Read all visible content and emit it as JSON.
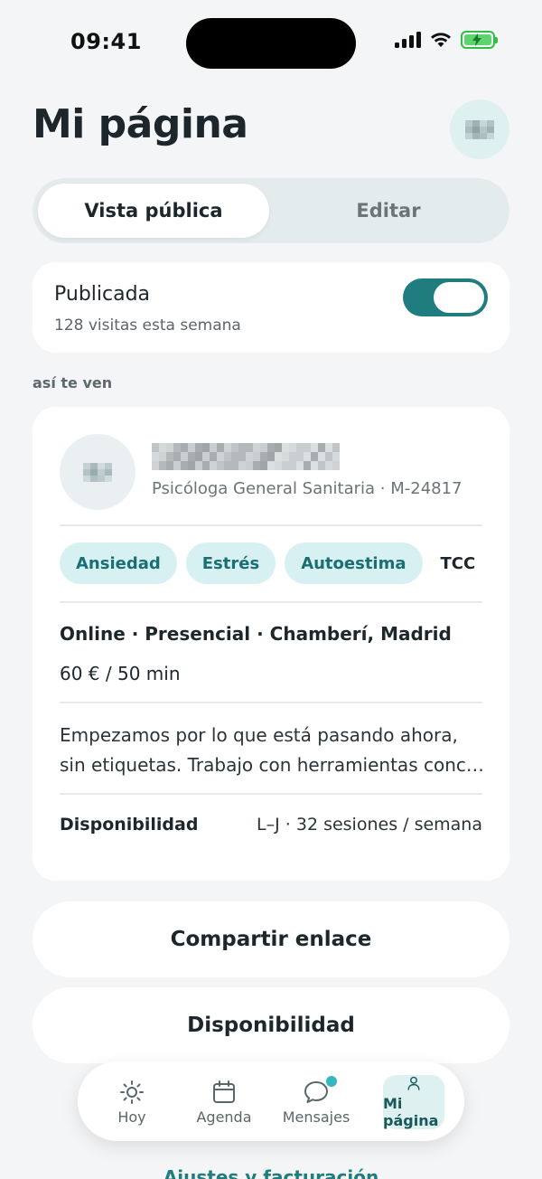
{
  "status_bar": {
    "time": "09:41"
  },
  "header": {
    "title": "Mi página"
  },
  "segmented": {
    "active": "Vista pública",
    "inactive": "Editar"
  },
  "publish": {
    "label": "Publicada",
    "visits": "128 visitas esta semana",
    "enabled": true
  },
  "preview_label": "así te ven",
  "profile": {
    "role": "Psicóloga General Sanitaria · M-24817",
    "chips": [
      "Ansiedad",
      "Estrés",
      "Autoestima",
      "TCC"
    ],
    "modes": "Online · Presencial · Chamberí, Madrid",
    "price": "60 € / 50 min",
    "bio_line1": "Empezamos por lo que está pasando ahora,",
    "bio_line2": "sin etiquetas. Trabajo con herramientas concr…",
    "availability_label": "Disponibilidad",
    "availability_value": "L–J · 32 sesiones / semana"
  },
  "actions": {
    "share": "Compartir enlace",
    "availability": "Disponibilidad"
  },
  "tabbar": {
    "items": [
      {
        "label": "Hoy",
        "icon": "sun-icon"
      },
      {
        "label": "Agenda",
        "icon": "calendar-icon"
      },
      {
        "label": "Mensajes",
        "icon": "chat-bubble-icon",
        "badge": true
      },
      {
        "label": "Mi página",
        "icon": "person-icon",
        "active": true
      }
    ]
  },
  "peek_link": "Ajustes y facturación",
  "colors": {
    "accent": "#1f7d80",
    "chip_bg": "#d7f1f3",
    "background": "#f3f5f6"
  }
}
